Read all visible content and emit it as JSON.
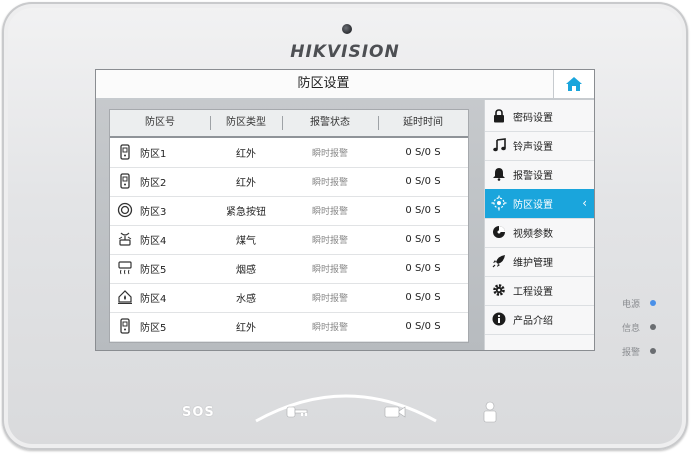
{
  "device": {
    "brand": "HIKVISION",
    "indicators": [
      {
        "label": "电源",
        "color": "#4a90e8"
      },
      {
        "label": "信息",
        "color": "#6a6d71"
      },
      {
        "label": "报警",
        "color": "#6a6d71"
      }
    ],
    "buttons": {
      "sos": "SOS",
      "key_icon": "key-icon",
      "camera_icon": "video-camera-icon",
      "user_icon": "resident-icon"
    }
  },
  "screen": {
    "title": "防区设置",
    "home_icon": "home-icon",
    "accent": "#1aa5dc",
    "table": {
      "headers": [
        "防区号",
        "防区类型",
        "报警状态",
        "延时时间"
      ],
      "rows": [
        {
          "icon": "door-sensor-icon",
          "zone": "防区1",
          "type": "红外",
          "state": "瞬时报警",
          "delay": "0 S/0 S"
        },
        {
          "icon": "door-sensor-icon",
          "zone": "防区2",
          "type": "红外",
          "state": "瞬时报警",
          "delay": "0 S/0 S"
        },
        {
          "icon": "panic-button-icon",
          "zone": "防区3",
          "type": "紧急按钮",
          "state": "瞬时报警",
          "delay": "0 S/0 S"
        },
        {
          "icon": "gas-detector-icon",
          "zone": "防区4",
          "type": "煤气",
          "state": "瞬时报警",
          "delay": "0 S/0 S"
        },
        {
          "icon": "smoke-detector-icon",
          "zone": "防区5",
          "type": "烟感",
          "state": "瞬时报警",
          "delay": "0 S/0 S"
        },
        {
          "icon": "water-sensor-icon",
          "zone": "防区4",
          "type": "水感",
          "state": "瞬时报警",
          "delay": "0 S/0 S"
        },
        {
          "icon": "door-sensor-icon",
          "zone": "防区5",
          "type": "红外",
          "state": "瞬时报警",
          "delay": "0 S/0 S"
        }
      ]
    },
    "menu": [
      {
        "label": "密码设置",
        "icon": "lock-icon",
        "active": false
      },
      {
        "label": "铃声设置",
        "icon": "music-note-icon",
        "active": false
      },
      {
        "label": "报警设置",
        "icon": "bell-icon",
        "active": false
      },
      {
        "label": "防区设置",
        "icon": "zone-radar-icon",
        "active": true
      },
      {
        "label": "视频参数",
        "icon": "video-params-icon",
        "active": false
      },
      {
        "label": "维护管理",
        "icon": "rocket-icon",
        "active": false
      },
      {
        "label": "工程设置",
        "icon": "gear-icon",
        "active": false
      },
      {
        "label": "产品介绍",
        "icon": "info-icon",
        "active": false
      }
    ]
  }
}
